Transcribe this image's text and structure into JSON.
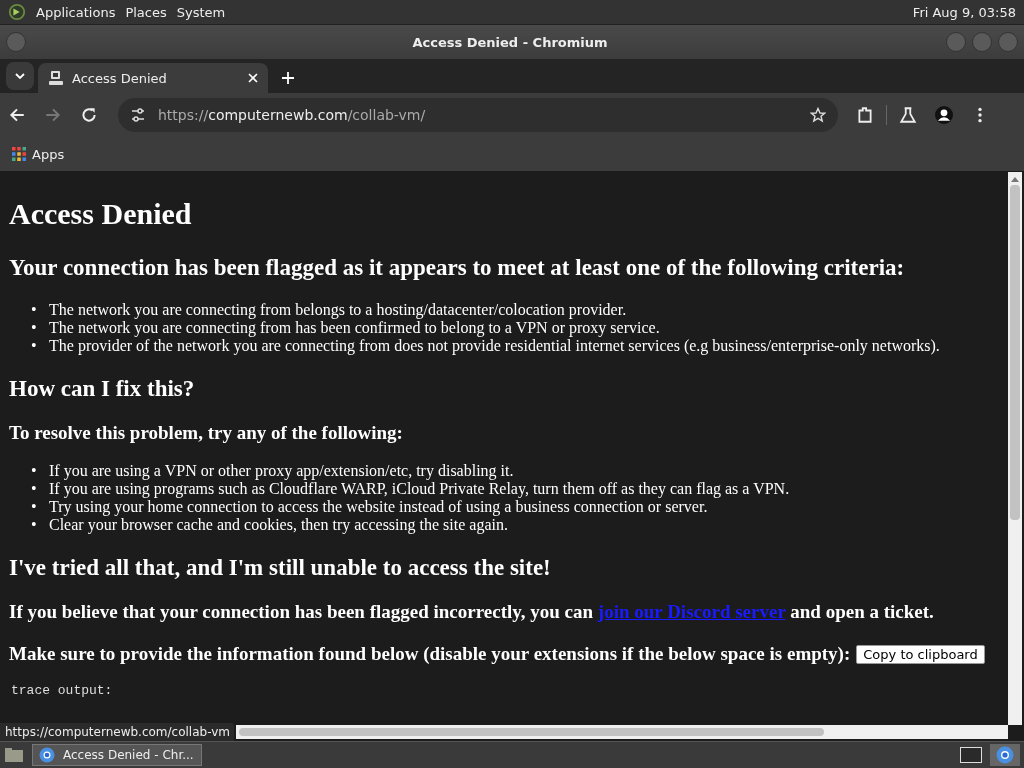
{
  "top_panel": {
    "menus": [
      "Applications",
      "Places",
      "System"
    ],
    "clock": "Fri Aug  9, 03:58"
  },
  "window": {
    "title": "Access Denied - Chromium"
  },
  "tabs": [
    {
      "label": "Access Denied",
      "selected": true
    }
  ],
  "toolbar": {
    "forward_disabled": true,
    "url": {
      "scheme": "https://",
      "host": "computernewb.com",
      "path": "/collab-vm/"
    }
  },
  "bookmarks": [
    {
      "label": "Apps"
    }
  ],
  "page": {
    "title": "Access Denied",
    "criteria_heading": "Your connection has been flagged as it appears to meet at least one of the following criteria:",
    "criteria": [
      {
        "bullet": "•",
        "text": "The network you are connecting from belongs to a hosting/datacenter/colocation provider."
      },
      {
        "bullet": "•",
        "text": "The network you are connecting from has been confirmed to belong to a VPN or proxy service."
      },
      {
        "bullet": "•",
        "text": "The provider of the network you are connecting from does not provide residential internet services (e.g business/enterprise-only networks)."
      }
    ],
    "fix_heading": "How can I fix this?",
    "resolve_heading": "To resolve this problem, try any of the following:",
    "steps": [
      {
        "bullet": "•",
        "text": "If you are using a VPN or other proxy app/extension/etc, try disabling it."
      },
      {
        "bullet": "•",
        "text": "If you are using programs such as Cloudflare WARP, iCloud Private Relay, turn them off as they can flag as a VPN."
      },
      {
        "bullet": "•",
        "text": "Try using your home connection to access the website instead of using a business connection or server."
      },
      {
        "bullet": "•",
        "text": "Clear your browser cache and cookies, then try accessing the site again."
      }
    ],
    "tried_heading": "I've tried all that, and I'm still unable to access the site!",
    "ticket": {
      "before": "If you believe that your connection has been flagged incorrectly, you can ",
      "link": "join our Discord server",
      "after": " and open a ticket."
    },
    "provide": "Make sure to provide the information found below (disable your extensions if the below space is empty):",
    "copy_button": "Copy to clipboard",
    "trace": "trace output:"
  },
  "status_url": "https://computernewb.com/collab-vm",
  "taskbar": {
    "tasks": [
      {
        "label": "Access Denied - Chr...",
        "selected": true
      }
    ]
  }
}
